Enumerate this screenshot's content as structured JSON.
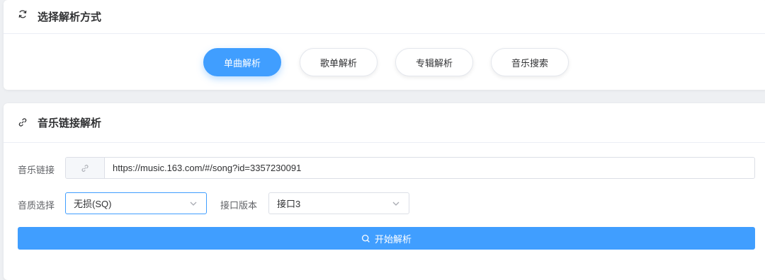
{
  "section1": {
    "title": "选择解析方式",
    "icon": "refresh-icon",
    "modes": [
      {
        "label": "单曲解析",
        "active": true
      },
      {
        "label": "歌单解析",
        "active": false
      },
      {
        "label": "专辑解析",
        "active": false
      },
      {
        "label": "音乐搜索",
        "active": false
      }
    ]
  },
  "section2": {
    "title": "音乐链接解析",
    "icon": "link-icon",
    "link_label": "音乐链接",
    "link_value": "https://music.163.com/#/song?id=3357230091",
    "quality_label": "音质选择",
    "quality_value": "无损(SQ)",
    "api_label": "接口版本",
    "api_value": "接口3",
    "start_button": "开始解析"
  },
  "colors": {
    "accent": "#409eff",
    "background": "#eef0f3",
    "card": "#ffffff"
  }
}
